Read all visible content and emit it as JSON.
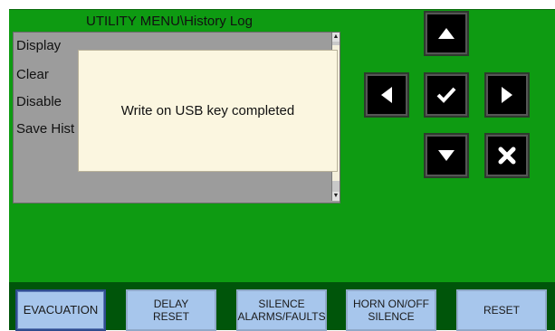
{
  "header": {
    "title": "UTILITY MENU\\History Log"
  },
  "menu": {
    "items": [
      {
        "label": "Display"
      },
      {
        "label": "Clear"
      },
      {
        "label": "Disable"
      },
      {
        "label": "Save Hist"
      }
    ]
  },
  "dialog": {
    "message": "Write on USB key completed"
  },
  "nav": {
    "up": "arrow-up-icon",
    "left": "arrow-left-icon",
    "ok": "checkmark-icon",
    "right": "arrow-right-icon",
    "down": "arrow-down-icon",
    "cancel": "x-icon"
  },
  "footer": {
    "evacuation": "EVACUATION",
    "delay_reset": "DELAY\nRESET",
    "silence": "SILENCE\nALARMS/FAULTS",
    "horn": "HORN ON/OFF\nSILENCE",
    "reset": "RESET"
  },
  "colors": {
    "panel_green": "#0e9b12",
    "bottom_bar": "#00550a",
    "button_blue": "#a7c6ec"
  }
}
